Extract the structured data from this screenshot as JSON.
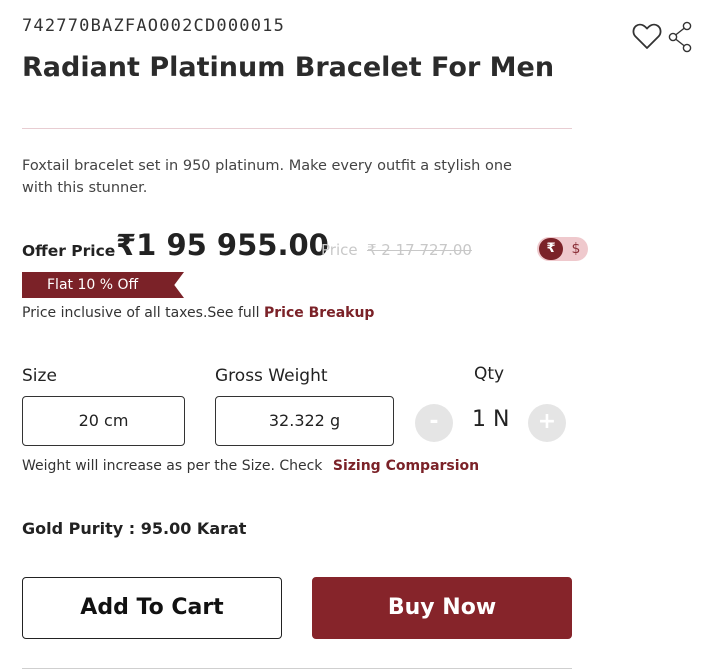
{
  "product": {
    "sku": "742770BAZFAO002CD000015",
    "title": "Radiant Platinum Bracelet For Men",
    "description": "Foxtail bracelet set in 950 platinum. Make every outfit a stylish one with this stunner."
  },
  "actions": {
    "wishlist_icon": "heart-icon",
    "share_icon": "share-icon"
  },
  "pricing": {
    "offer_label": "Offer Price",
    "offer_price": "₹1 95 955.00",
    "old_price_label": "Price",
    "old_price": "₹ 2 17 727.00",
    "discount_badge": "Flat 10 % Off",
    "tax_note": "Price inclusive of all taxes.See full",
    "breakup_link": "Price Breakup",
    "currency_toggle": {
      "active": "₹",
      "inactive": "$"
    }
  },
  "options": {
    "size_label": "Size",
    "size_value": "20 cm",
    "weight_label": "Gross Weight",
    "weight_value": "32.322 g",
    "qty_label": "Qty",
    "qty_value": "1 N",
    "qty_minus": "-",
    "qty_plus": "+",
    "weight_note": "Weight will increase as per the Size. Check",
    "sizing_link": "Sizing Comparsion"
  },
  "purity": "Gold Purity : 95.00 Karat",
  "buttons": {
    "add_to_cart": "Add To Cart",
    "buy_now": "Buy Now"
  },
  "colors": {
    "brand": "#86242a",
    "brand_light": "#efc9cd",
    "muted": "#c8c8c8"
  }
}
